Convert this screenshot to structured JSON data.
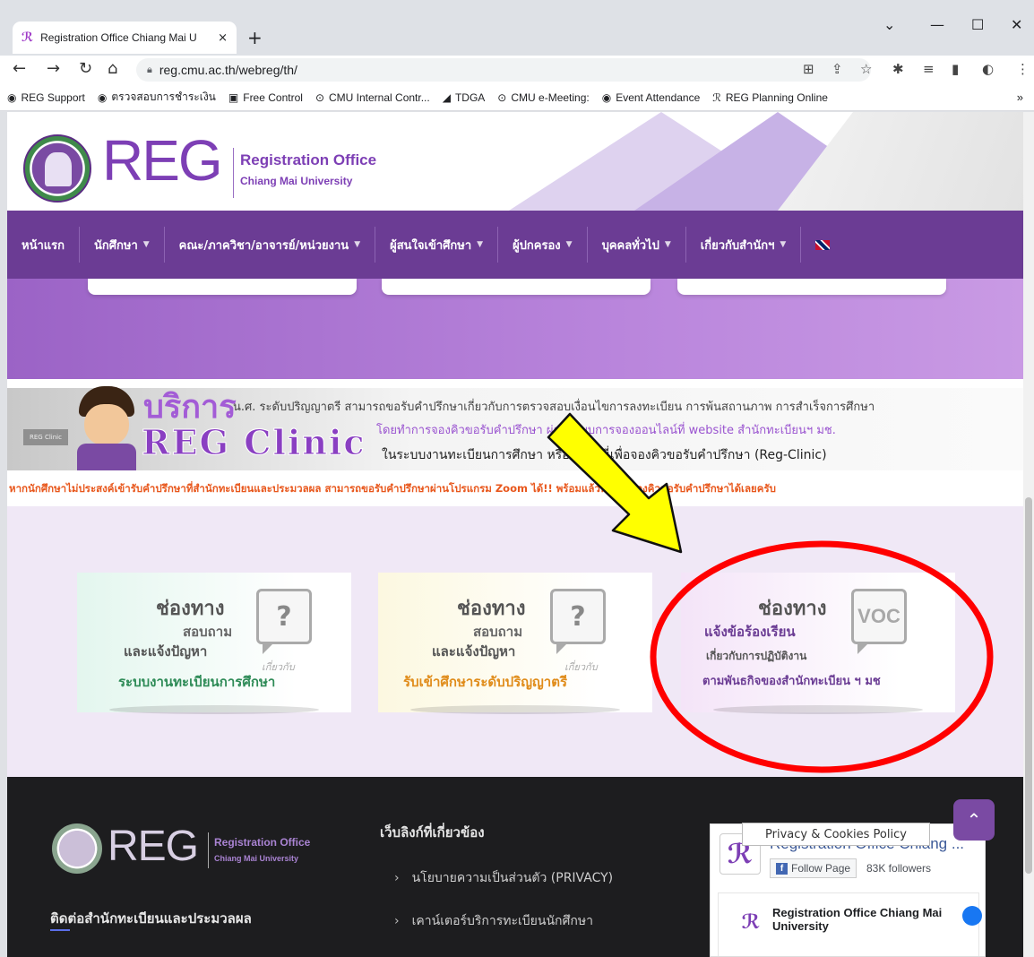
{
  "browser": {
    "tab_title": "Registration Office Chiang Mai U",
    "tab_close": "×",
    "new_tab": "+",
    "url": "reg.cmu.ac.th/webreg/th/",
    "bookmarks": [
      {
        "icon": "globe-icon",
        "glyph": "◉",
        "label": "REG Support"
      },
      {
        "icon": "globe-icon",
        "glyph": "◉",
        "label": "ตรวจสอบการชำระเงิน"
      },
      {
        "icon": "folder-icon",
        "glyph": "▣",
        "label": "Free Control"
      },
      {
        "icon": "circle-icon",
        "glyph": "⊙",
        "label": "CMU Internal Contr..."
      },
      {
        "icon": "tdga-icon",
        "glyph": "◢",
        "label": "TDGA"
      },
      {
        "icon": "circle-icon",
        "glyph": "⊙",
        "label": "CMU e-Meeting:"
      },
      {
        "icon": "globe-icon",
        "glyph": "◉",
        "label": "Event Attendance"
      },
      {
        "icon": "reg-icon",
        "glyph": "ℛ",
        "label": "REG Planning Online"
      }
    ],
    "bookmarks_more": "»"
  },
  "header": {
    "logo_word": "REG",
    "logo_sub1": "Registration Office",
    "logo_sub2": "Chiang Mai University"
  },
  "nav": {
    "items": [
      {
        "label": "หน้าแรก",
        "dropdown": false
      },
      {
        "label": "นักศึกษา",
        "dropdown": true
      },
      {
        "label": "คณะ/ภาควิชา/อาจารย์/หน่วยงาน",
        "dropdown": true
      },
      {
        "label": "ผู้สนใจเข้าศึกษา",
        "dropdown": true
      },
      {
        "label": "ผู้ปกครอง",
        "dropdown": true
      },
      {
        "label": "บุคคลทั่วไป",
        "dropdown": true
      },
      {
        "label": "เกี่ยวกับสำนักฯ",
        "dropdown": true
      }
    ],
    "caret": "▼"
  },
  "clinic": {
    "title1": "บริการ",
    "title2": "REG Clinic",
    "side_label": "REG Clinic",
    "line1": "น.ศ. ระดับปริญญาตรี สามารถขอรับคำปรึกษาเกี่ยวกับการตรวจสอบเงื่อนไขการลงทะเบียน การพ้นสถานภาพ การสำเร็จการศึกษา",
    "line2": "โดยทำการจองคิวขอรับคำปรึกษา ผ่านระบบการจองออนไลน์ที่ website สำนักทะเบียนฯ มช.",
    "line3": "ในระบบงานทะเบียนการศึกษา หรือคลิกที่นี่เพื่อจองคิวขอรับคำปรึกษา (Reg-Clinic)",
    "notice": "หากนักศึกษาไม่ประสงค์เข้ารับคำปรึกษาที่สำนักทะเบียนและประมวลผล สามารถขอรับคำปรึกษาผ่านโปรแกรม Zoom ได้!! พร้อมแล้วทำการจองคิวขอรับคำปรึกษาได้เลยครับ"
  },
  "channels": [
    {
      "title": "ช่องทาง",
      "line2": "สอบถาม",
      "line3": "และแจ้งปัญหา",
      "about": "เกี่ยวกับ",
      "line4": "ระบบงานทะเบียนการศึกษา",
      "icon": "question-head-icon",
      "glyph": "?"
    },
    {
      "title": "ช่องทาง",
      "line2": "สอบถาม",
      "line3": "และแจ้งปัญหา",
      "about": "เกี่ยวกับ",
      "line4": "รับเข้าศึกษาระดับปริญญาตรี",
      "icon": "question-head-icon",
      "glyph": "?"
    },
    {
      "title": "ช่องทาง",
      "line2": "แจ้งข้อร้องเรียน",
      "line3": "เกี่ยวกับการปฏิบัติงาน",
      "about": "",
      "line4": "ตามพันธกิจของสำนักทะเบียน ฯ มช",
      "icon": "voc-icon",
      "glyph": "VOC"
    }
  ],
  "footer": {
    "logo_word": "REG",
    "logo_sub1": "Registration Office",
    "logo_sub2": "Chiang Mai University",
    "contact_title": "ติดต่อสำนักทะเบียนและประมวลผล",
    "links_title": "เว็บลิงก์ที่เกี่ยวข้อง",
    "links": [
      "นโยบายความเป็นส่วนตัว (PRIVACY)",
      "เคาน์เตอร์บริการทะเบียนนักศึกษา"
    ],
    "link_chevron": "›"
  },
  "facebook": {
    "page_name": "Registration Office Chiang ...",
    "follow_label": "Follow Page",
    "followers": "83K followers",
    "post_name": "Registration Office Chiang Mai University"
  },
  "privacy_label": "Privacy & Cookies Policy",
  "back_to_top": "⌃",
  "colors": {
    "brand_purple": "#6b3c94",
    "annotation_red": "#ff0000",
    "annotation_arrow": "#ffff00"
  }
}
